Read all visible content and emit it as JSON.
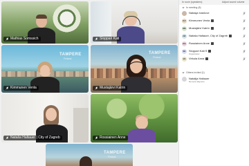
{
  "tiles": [
    {
      "name": "Mathias Somssich",
      "brand": "",
      "brand_sub": ""
    },
    {
      "name": "Sloppari Kati",
      "brand": "",
      "brand_sub": ""
    },
    {
      "name": "Kimmunen Venla",
      "brand": "TAMPERE",
      "brand_sub": "Finland"
    },
    {
      "name": "Mustajärvi Katrin",
      "brand": "TAMPERE",
      "brand_sub": "Finland"
    },
    {
      "name": "Nataša Haltauer | City of Zagreb",
      "brand": "",
      "brand_sub": ""
    },
    {
      "name": "Rossiainen Anne",
      "brand": "",
      "brand_sub": ""
    },
    {
      "name": "",
      "brand": "TAMPERE",
      "brand_sub": "Finland"
    }
  ],
  "panel": {
    "tab_left": "In room (speakers)",
    "tab_right": "Adjust sound volume",
    "section_in_meeting": "In meeting (8)",
    "section_invited": "Others invited (1)",
    "participants": [
      {
        "initials": "",
        "name": "Natasja Ivankovi",
        "sub": "",
        "badge": false,
        "color": "#c9b8a8"
      },
      {
        "initials": "KV",
        "name": "Kimmunen Venla",
        "sub": "",
        "badge": true,
        "color": "#e8d9c4"
      },
      {
        "initials": "MK",
        "name": "Mustajärvi Katrin",
        "sub": "",
        "badge": true,
        "color": "#d8e6d0"
      },
      {
        "initials": "NZ",
        "name": "Nataša Haltauer, City of Zagreb",
        "sub": "",
        "badge": true,
        "color": "#cfe3e6"
      },
      {
        "initials": "RA",
        "name": "Rossiainen Anne",
        "sub": "",
        "badge": true,
        "color": "#e9d4dd"
      },
      {
        "initials": "SK",
        "name": "Sloppari Kati S",
        "sub": "Organizator",
        "badge": true,
        "color": "#d9ddf0"
      },
      {
        "initials": "VA",
        "name": "Virkula Anna",
        "sub": "",
        "badge": true,
        "color": "#e6e1c8"
      }
    ],
    "invited": [
      {
        "initials": "",
        "name": "Natalija Haltauer",
        "sub": "Remote aligmore",
        "color": "#d6d6d6"
      }
    ]
  }
}
